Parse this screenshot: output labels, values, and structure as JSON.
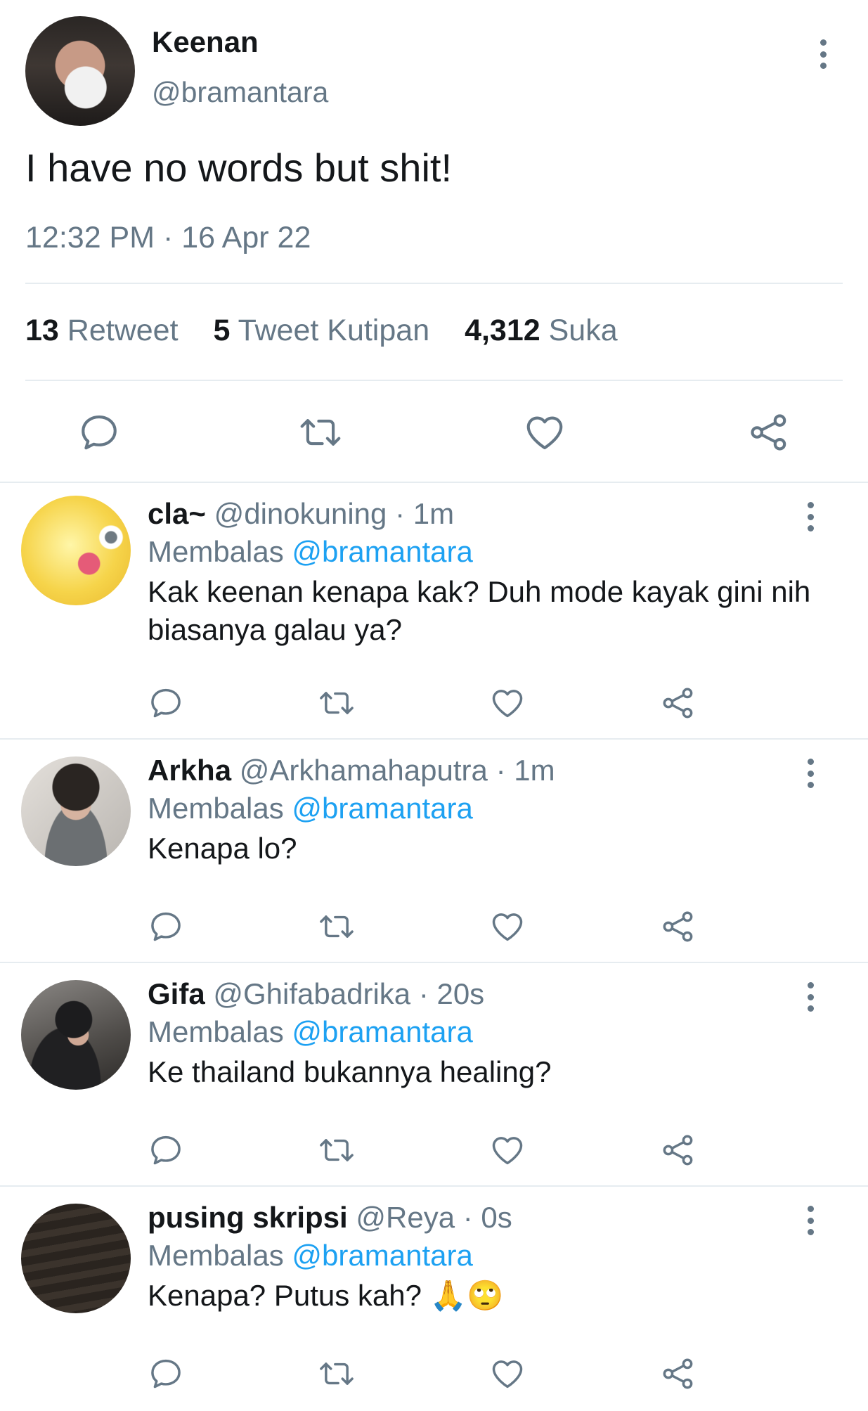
{
  "tweet": {
    "author_name": "Keenan",
    "author_handle": "@bramantara",
    "text": "I have no words but shit!",
    "timestamp": "12:32 PM · 16 Apr 22",
    "stats": {
      "retweets_count": "13",
      "retweets_label": "Retweet",
      "quotes_count": "5",
      "quotes_label": "Tweet Kutipan",
      "likes_count": "4,312",
      "likes_label": "Suka"
    },
    "actions": [
      "reply-icon",
      "retweet-icon",
      "like-icon",
      "share-icon"
    ]
  },
  "replies": [
    {
      "name": "cla~",
      "handle": "@dinokuning",
      "time": "· 1m",
      "replying_prefix": "Membalas",
      "replying_to": "@bramantara",
      "text": "Kak keenan kenapa kak? Duh mode kayak gini nih biasanya galau ya?"
    },
    {
      "name": "Arkha",
      "handle": "@Arkhamahaputra",
      "time": "· 1m",
      "replying_prefix": "Membalas",
      "replying_to": "@bramantara",
      "text": "Kenapa lo?"
    },
    {
      "name": "Gifa",
      "handle": "@Ghifabadrika",
      "time": "· 20s",
      "replying_prefix": "Membalas",
      "replying_to": "@bramantara",
      "text": "Ke thailand bukannya healing?"
    },
    {
      "name": "pusing skripsi",
      "handle": "@Reya",
      "time": "· 0s",
      "replying_prefix": "Membalas",
      "replying_to": "@bramantara",
      "text": "Kenapa? Putus kah? 🙏🙄"
    }
  ],
  "colors": {
    "text": "#14171a",
    "secondary": "#657786",
    "mention": "#1da1f2",
    "divider": "#e6ecf0"
  }
}
